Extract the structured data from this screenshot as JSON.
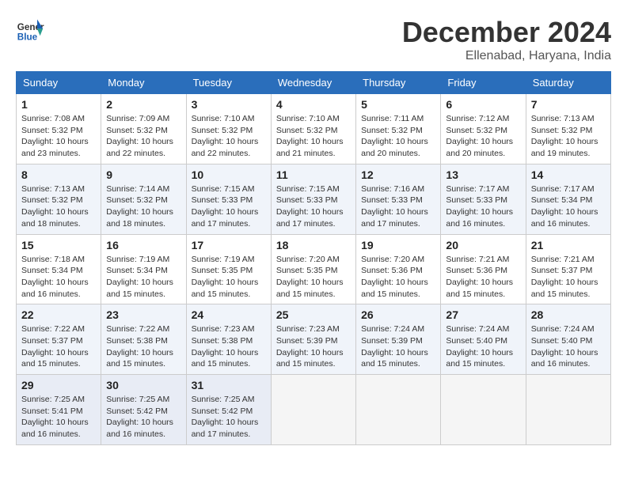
{
  "header": {
    "logo_line1": "General",
    "logo_line2": "Blue",
    "month": "December 2024",
    "location": "Ellenabad, Haryana, India"
  },
  "weekdays": [
    "Sunday",
    "Monday",
    "Tuesday",
    "Wednesday",
    "Thursday",
    "Friday",
    "Saturday"
  ],
  "weeks": [
    [
      {
        "day": "1",
        "info": "Sunrise: 7:08 AM\nSunset: 5:32 PM\nDaylight: 10 hours\nand 23 minutes."
      },
      {
        "day": "2",
        "info": "Sunrise: 7:09 AM\nSunset: 5:32 PM\nDaylight: 10 hours\nand 22 minutes."
      },
      {
        "day": "3",
        "info": "Sunrise: 7:10 AM\nSunset: 5:32 PM\nDaylight: 10 hours\nand 22 minutes."
      },
      {
        "day": "4",
        "info": "Sunrise: 7:10 AM\nSunset: 5:32 PM\nDaylight: 10 hours\nand 21 minutes."
      },
      {
        "day": "5",
        "info": "Sunrise: 7:11 AM\nSunset: 5:32 PM\nDaylight: 10 hours\nand 20 minutes."
      },
      {
        "day": "6",
        "info": "Sunrise: 7:12 AM\nSunset: 5:32 PM\nDaylight: 10 hours\nand 20 minutes."
      },
      {
        "day": "7",
        "info": "Sunrise: 7:13 AM\nSunset: 5:32 PM\nDaylight: 10 hours\nand 19 minutes."
      }
    ],
    [
      {
        "day": "8",
        "info": "Sunrise: 7:13 AM\nSunset: 5:32 PM\nDaylight: 10 hours\nand 18 minutes."
      },
      {
        "day": "9",
        "info": "Sunrise: 7:14 AM\nSunset: 5:32 PM\nDaylight: 10 hours\nand 18 minutes."
      },
      {
        "day": "10",
        "info": "Sunrise: 7:15 AM\nSunset: 5:33 PM\nDaylight: 10 hours\nand 17 minutes."
      },
      {
        "day": "11",
        "info": "Sunrise: 7:15 AM\nSunset: 5:33 PM\nDaylight: 10 hours\nand 17 minutes."
      },
      {
        "day": "12",
        "info": "Sunrise: 7:16 AM\nSunset: 5:33 PM\nDaylight: 10 hours\nand 17 minutes."
      },
      {
        "day": "13",
        "info": "Sunrise: 7:17 AM\nSunset: 5:33 PM\nDaylight: 10 hours\nand 16 minutes."
      },
      {
        "day": "14",
        "info": "Sunrise: 7:17 AM\nSunset: 5:34 PM\nDaylight: 10 hours\nand 16 minutes."
      }
    ],
    [
      {
        "day": "15",
        "info": "Sunrise: 7:18 AM\nSunset: 5:34 PM\nDaylight: 10 hours\nand 16 minutes."
      },
      {
        "day": "16",
        "info": "Sunrise: 7:19 AM\nSunset: 5:34 PM\nDaylight: 10 hours\nand 15 minutes."
      },
      {
        "day": "17",
        "info": "Sunrise: 7:19 AM\nSunset: 5:35 PM\nDaylight: 10 hours\nand 15 minutes."
      },
      {
        "day": "18",
        "info": "Sunrise: 7:20 AM\nSunset: 5:35 PM\nDaylight: 10 hours\nand 15 minutes."
      },
      {
        "day": "19",
        "info": "Sunrise: 7:20 AM\nSunset: 5:36 PM\nDaylight: 10 hours\nand 15 minutes."
      },
      {
        "day": "20",
        "info": "Sunrise: 7:21 AM\nSunset: 5:36 PM\nDaylight: 10 hours\nand 15 minutes."
      },
      {
        "day": "21",
        "info": "Sunrise: 7:21 AM\nSunset: 5:37 PM\nDaylight: 10 hours\nand 15 minutes."
      }
    ],
    [
      {
        "day": "22",
        "info": "Sunrise: 7:22 AM\nSunset: 5:37 PM\nDaylight: 10 hours\nand 15 minutes."
      },
      {
        "day": "23",
        "info": "Sunrise: 7:22 AM\nSunset: 5:38 PM\nDaylight: 10 hours\nand 15 minutes."
      },
      {
        "day": "24",
        "info": "Sunrise: 7:23 AM\nSunset: 5:38 PM\nDaylight: 10 hours\nand 15 minutes."
      },
      {
        "day": "25",
        "info": "Sunrise: 7:23 AM\nSunset: 5:39 PM\nDaylight: 10 hours\nand 15 minutes."
      },
      {
        "day": "26",
        "info": "Sunrise: 7:24 AM\nSunset: 5:39 PM\nDaylight: 10 hours\nand 15 minutes."
      },
      {
        "day": "27",
        "info": "Sunrise: 7:24 AM\nSunset: 5:40 PM\nDaylight: 10 hours\nand 15 minutes."
      },
      {
        "day": "28",
        "info": "Sunrise: 7:24 AM\nSunset: 5:40 PM\nDaylight: 10 hours\nand 16 minutes."
      }
    ],
    [
      {
        "day": "29",
        "info": "Sunrise: 7:25 AM\nSunset: 5:41 PM\nDaylight: 10 hours\nand 16 minutes."
      },
      {
        "day": "30",
        "info": "Sunrise: 7:25 AM\nSunset: 5:42 PM\nDaylight: 10 hours\nand 16 minutes."
      },
      {
        "day": "31",
        "info": "Sunrise: 7:25 AM\nSunset: 5:42 PM\nDaylight: 10 hours\nand 17 minutes."
      },
      {
        "day": "",
        "info": ""
      },
      {
        "day": "",
        "info": ""
      },
      {
        "day": "",
        "info": ""
      },
      {
        "day": "",
        "info": ""
      }
    ]
  ]
}
